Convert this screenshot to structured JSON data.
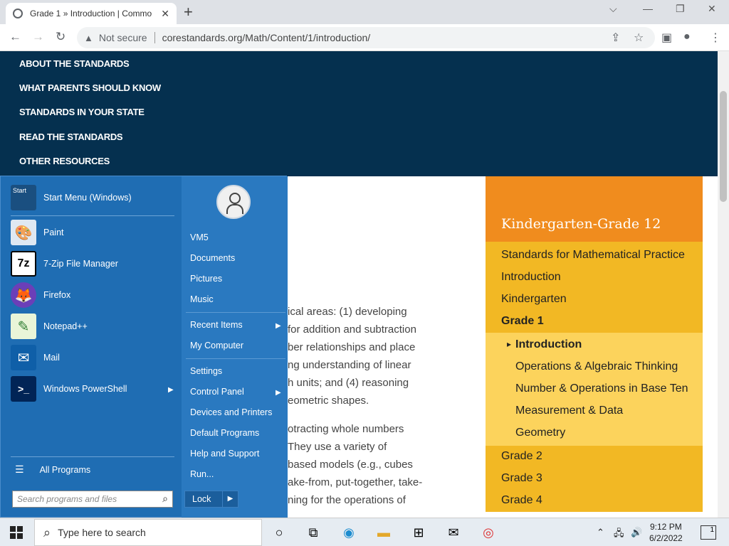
{
  "browser": {
    "tab_title": "Grade 1 » Introduction | Commo",
    "new_tab": "+",
    "close_tab": "✕",
    "not_secure": "Not secure",
    "url": "corestandards.org/Math/Content/1/introduction/",
    "window_controls": {
      "collapse": "⌵",
      "minimize": "—",
      "restore": "❐",
      "close": "✕"
    }
  },
  "topnav": {
    "items": [
      "ABOUT THE STANDARDS",
      "WHAT PARENTS SHOULD KNOW",
      "STANDARDS IN YOUR STATE",
      "READ THE STANDARDS",
      "OTHER RESOURCES"
    ]
  },
  "sidebar": {
    "heading": "Kindergarten-Grade 12",
    "links": [
      "Standards for Mathematical Practice",
      "Introduction",
      "Kindergarten"
    ],
    "current_grade": "Grade 1",
    "subs": [
      "Introduction",
      "Operations & Algebraic Thinking",
      "Number & Operations in Base Ten",
      "Measurement & Data",
      "Geometry"
    ],
    "more": [
      "Grade 2",
      "Grade 3",
      "Grade 4"
    ]
  },
  "body_text": {
    "p1": [
      "ical areas: (1) developing",
      "for addition and subtraction",
      "ber relationships and place",
      "ng understanding of linear",
      "h units; and (4) reasoning",
      "eometric shapes."
    ],
    "p2": [
      "otracting whole numbers",
      "They use a variety of",
      "based models (e.g., cubes",
      "ake-from, put-together, take-",
      "ning for the operations of"
    ]
  },
  "startmenu": {
    "pinned": [
      {
        "label": "Start Menu (Windows)",
        "icon": "start-menu-icon",
        "glyph": "Start"
      },
      {
        "label": "Paint",
        "icon": "paint-icon",
        "glyph": "🎨"
      },
      {
        "label": "7-Zip File Manager",
        "icon": "7zip-icon",
        "glyph": "7z"
      },
      {
        "label": "Firefox",
        "icon": "firefox-icon",
        "glyph": "🦊"
      },
      {
        "label": "Notepad++",
        "icon": "notepadpp-icon",
        "glyph": "✎"
      },
      {
        "label": "Mail",
        "icon": "mail-icon",
        "glyph": "✉"
      },
      {
        "label": "Windows PowerShell",
        "icon": "powershell-icon",
        "glyph": ">_"
      }
    ],
    "all_programs": "All Programs",
    "search_placeholder": "Search programs and files",
    "right_items": [
      "VM5",
      "Documents",
      "Pictures",
      "Music",
      "Recent Items",
      "My Computer",
      "Settings",
      "Control Panel",
      "Devices and Printers",
      "Default Programs",
      "Help and Support",
      "Run..."
    ],
    "lock": "Lock"
  },
  "taskbar": {
    "search_text": "Type here to search",
    "time": "9:12 PM",
    "date": "6/2/2022",
    "notification_count": "1"
  },
  "colors": {
    "topnav_bg": "#05304f",
    "sidebar_head": "#f08c1e",
    "sidebar_sec": "#f2b824",
    "sidebar_sub": "#fcd35c",
    "startmenu_bg": "#1f6db3"
  }
}
